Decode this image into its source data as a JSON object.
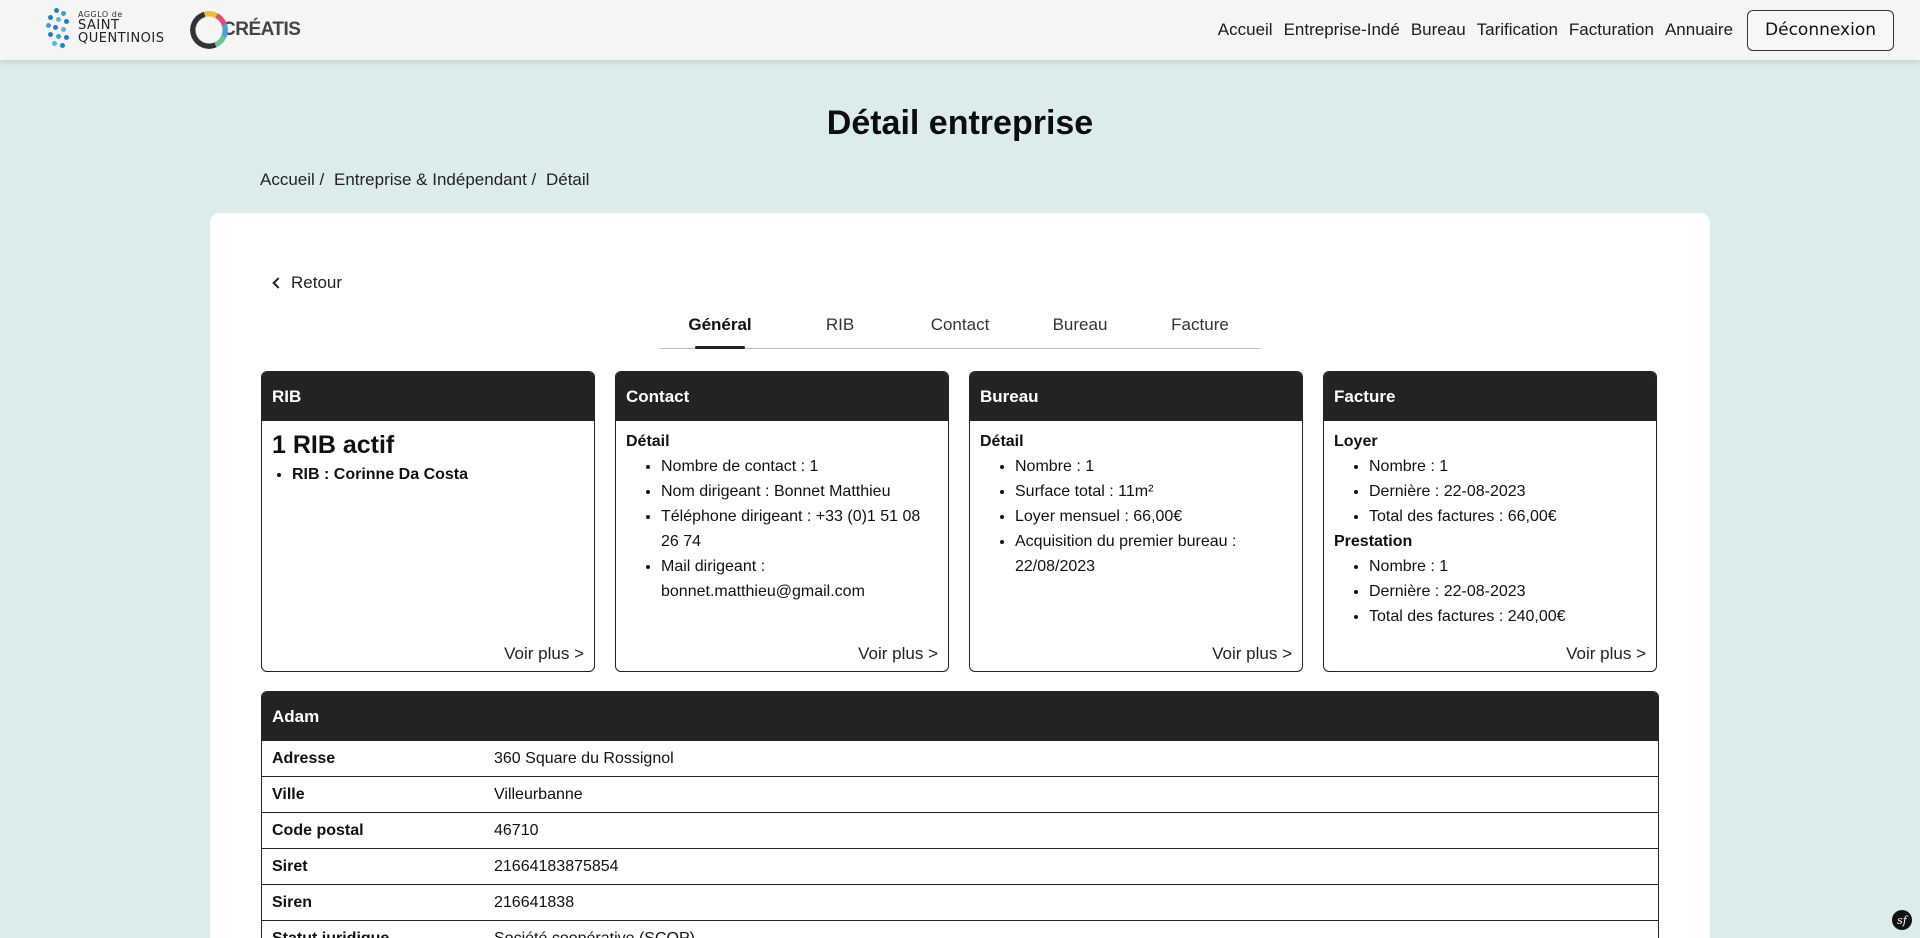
{
  "header": {
    "logo_agglo": {
      "line1": "AGGLO de",
      "line2": "SAINT",
      "line3": "QUENTINOIS"
    },
    "logo_creatis": "CRÉATIS",
    "nav": [
      {
        "label": "Accueil"
      },
      {
        "label": "Entreprise-Indé"
      },
      {
        "label": "Bureau"
      },
      {
        "label": "Tarification"
      },
      {
        "label": "Facturation"
      },
      {
        "label": "Annuaire"
      }
    ],
    "logout_label": "Déconnexion"
  },
  "page_title": "Détail entreprise",
  "breadcrumb": [
    "Accueil /",
    "Entreprise & Indépendant /",
    "Détail"
  ],
  "back_label": "Retour",
  "tabs": [
    {
      "label": "Général",
      "active": true
    },
    {
      "label": "RIB"
    },
    {
      "label": "Contact"
    },
    {
      "label": "Bureau"
    },
    {
      "label": "Facture"
    }
  ],
  "boxes": {
    "rib": {
      "title": "RIB",
      "headline": "1 RIB actif",
      "items": [
        "RIB : Corinne Da Costa"
      ],
      "more": "Voir plus >"
    },
    "contact": {
      "title": "Contact",
      "subtitle": "Détail",
      "items": [
        "Nombre de contact : 1",
        "Nom dirigeant : Bonnet Matthieu",
        "Téléphone dirigeant : +33 (0)1 51 08 26 74",
        "Mail dirigeant : bonnet.matthieu@gmail.com"
      ],
      "more": "Voir plus >"
    },
    "bureau": {
      "title": "Bureau",
      "subtitle": "Détail",
      "items": [
        "Nombre : 1",
        "Surface total : 11m²",
        "Loyer mensuel : 66,00€",
        "Acquisition du premier bureau : 22/08/2023"
      ],
      "more": "Voir plus >"
    },
    "facture": {
      "title": "Facture",
      "loyer_title": "Loyer",
      "loyer_items": [
        "Nombre : 1",
        "Dernière : 22-08-2023",
        "Total des factures : 66,00€"
      ],
      "prestation_title": "Prestation",
      "prestation_items": [
        "Nombre : 1",
        "Dernière : 22-08-2023",
        "Total des factures : 240,00€"
      ],
      "more": "Voir plus >"
    }
  },
  "company": {
    "name": "Adam",
    "rows": [
      {
        "label": "Adresse",
        "value": "360 Square du Rossignol"
      },
      {
        "label": "Ville",
        "value": "Villeurbanne"
      },
      {
        "label": "Code postal",
        "value": "46710"
      },
      {
        "label": "Siret",
        "value": "21664183875854"
      },
      {
        "label": "Siren",
        "value": "216641838"
      },
      {
        "label": "Statut juridique",
        "value": "Société coopérative (SCOP)"
      }
    ]
  },
  "symfony_badge": "sf"
}
